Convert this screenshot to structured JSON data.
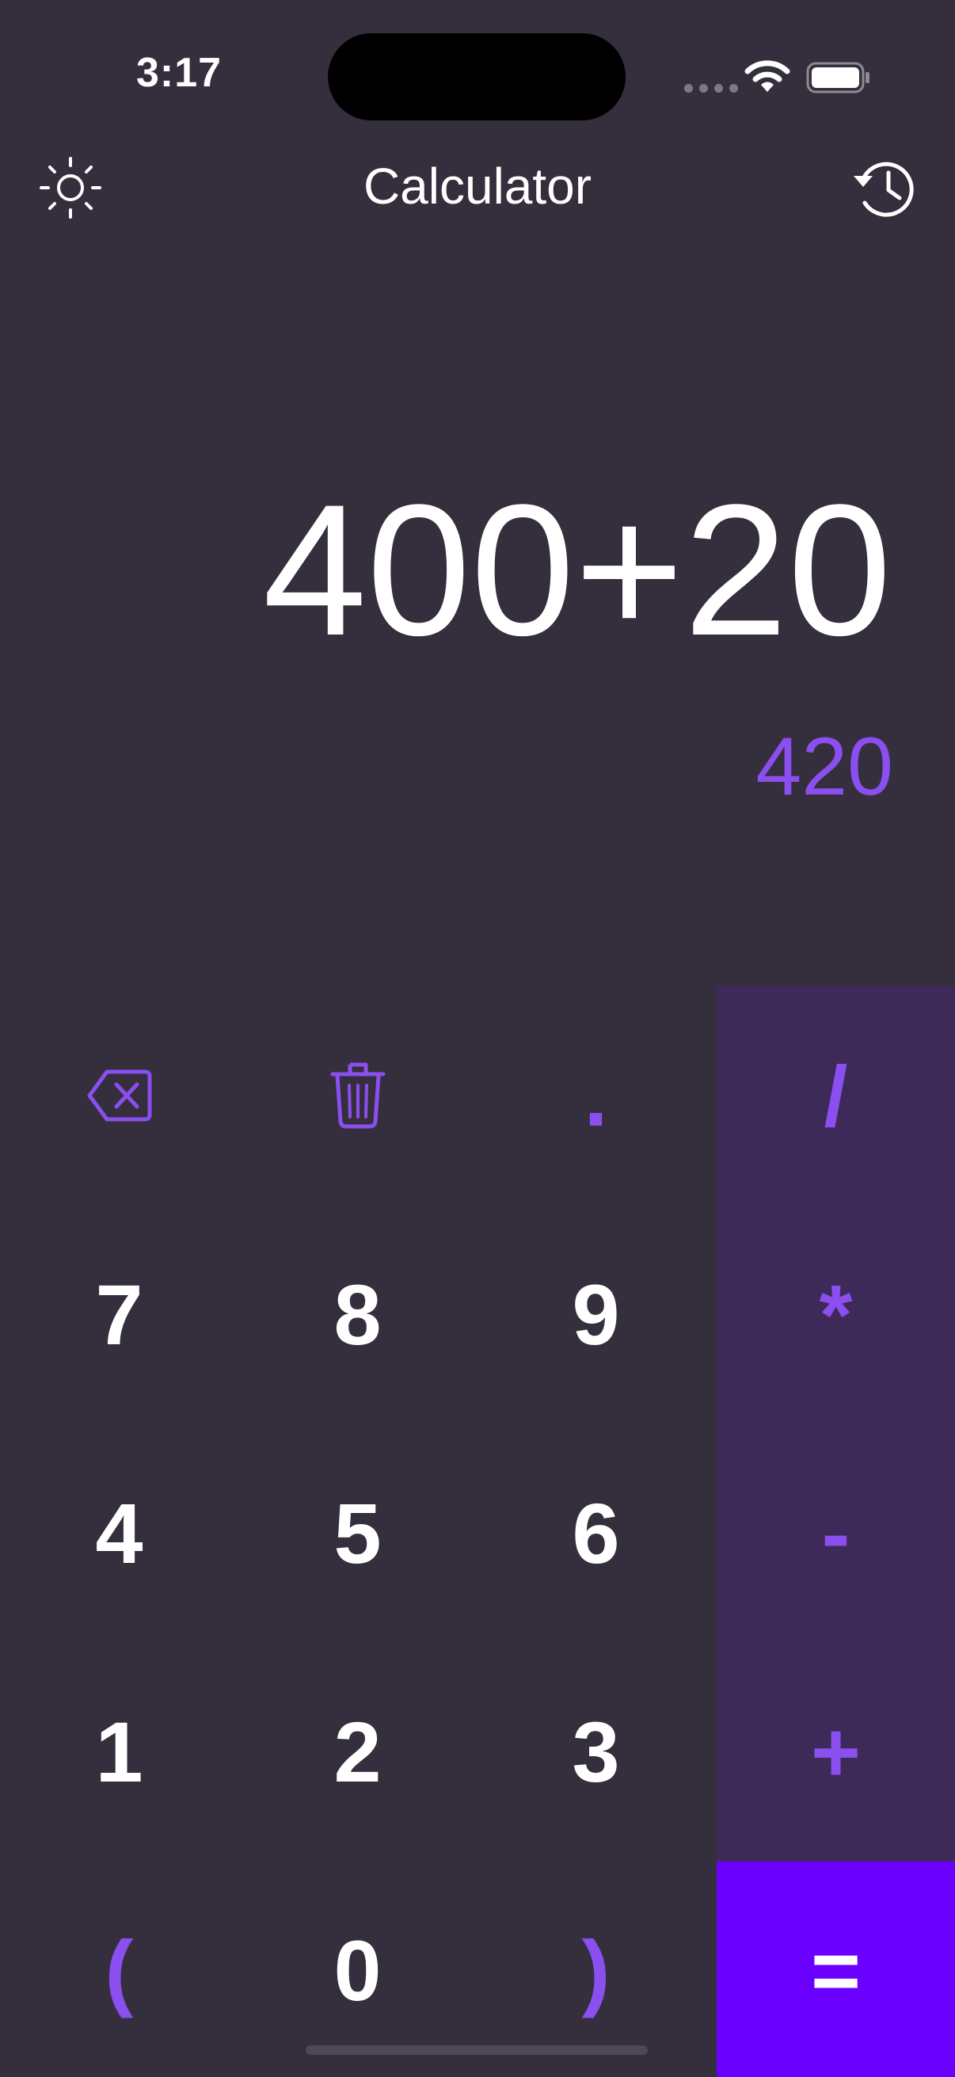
{
  "status_bar": {
    "time": "3:17",
    "icons": [
      "signal-dots-icon",
      "wifi-icon",
      "battery-icon"
    ]
  },
  "header": {
    "title": "Calculator",
    "left_icon": "sun-icon",
    "right_icon": "history-icon"
  },
  "display": {
    "expression": "400+20",
    "result": "420"
  },
  "keypad": {
    "rows": [
      [
        "backspace",
        "clear",
        ".",
        "/"
      ],
      [
        "7",
        "8",
        "9",
        "*"
      ],
      [
        "4",
        "5",
        "6",
        "-"
      ],
      [
        "1",
        "2",
        "3",
        "+"
      ],
      [
        "(",
        "0",
        ")",
        "="
      ]
    ],
    "backspace_icon": "backspace-icon",
    "clear_icon": "trash-icon"
  },
  "colors": {
    "background": "#352e3c",
    "operator_column": "#3e2a58",
    "accent": "#8a4fee",
    "equals_button": "#6a00ff",
    "text": "#ffffff"
  }
}
